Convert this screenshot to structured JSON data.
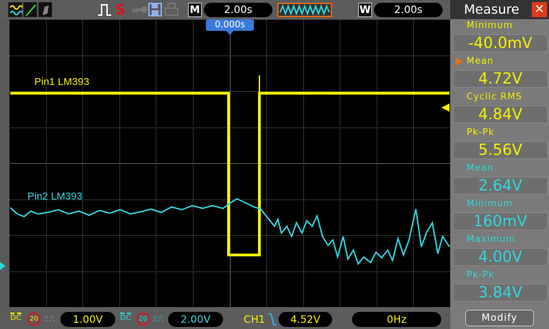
{
  "toolbar": {
    "mode_label": "M",
    "timebase": "2.00s",
    "window_label": "W",
    "window_timebase": "2.00s",
    "stop_label": "S"
  },
  "trigger_time": "0.000s",
  "channels": [
    {
      "label": "Pin1 LM393",
      "coupling": "DC",
      "bw_limit": "20",
      "scale": "1.00V",
      "color": "#f5f000"
    },
    {
      "label": "Pin2 LM393",
      "coupling": "DC",
      "bw_limit": "20",
      "scale": "2.00V",
      "color": "#30d8e0"
    }
  ],
  "trigger": {
    "source": "CH1",
    "level": "4.52V"
  },
  "frequency": "0Hz",
  "measure": {
    "title": "Measure",
    "items": [
      {
        "label": "Minimum",
        "value": "-40.0mV",
        "channel": "ch1"
      },
      {
        "label": "Mean",
        "value": "4.72V",
        "channel": "ch1",
        "selected": true
      },
      {
        "label": "Cyclic RMS",
        "value": "4.84V",
        "channel": "ch1"
      },
      {
        "label": "Pk-Pk",
        "value": "5.56V",
        "channel": "ch1"
      },
      {
        "label": "Mean",
        "value": "2.64V",
        "channel": "ch2"
      },
      {
        "label": "Minimum",
        "value": "160mV",
        "channel": "ch2"
      },
      {
        "label": "Maximum",
        "value": "4.00V",
        "channel": "ch2"
      },
      {
        "label": "Pk-Pk",
        "value": "3.84V",
        "channel": "ch2"
      }
    ],
    "modify_label": "Modify"
  }
}
